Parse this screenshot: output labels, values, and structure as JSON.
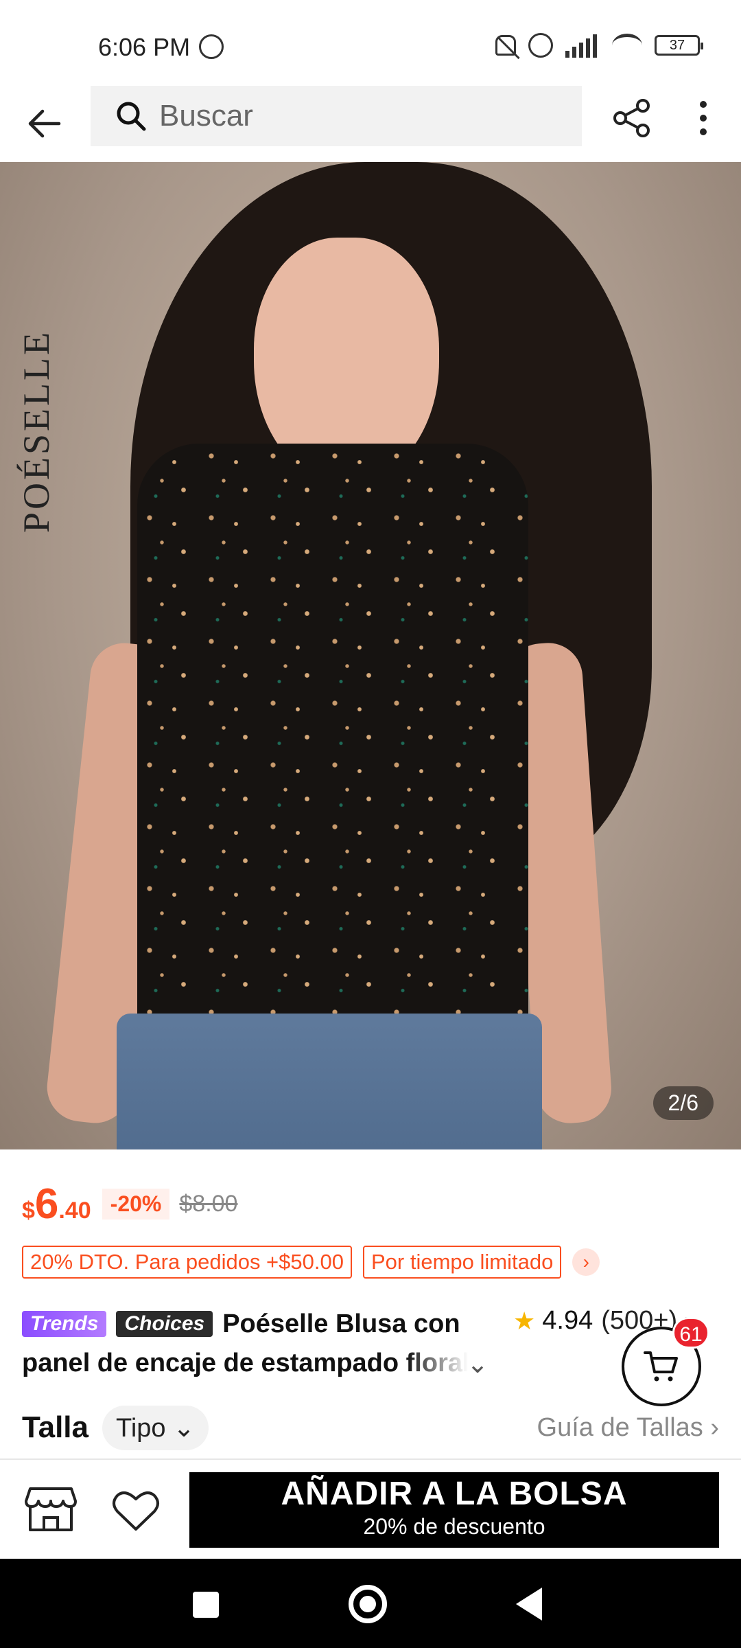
{
  "status_bar": {
    "time": "6:06 PM",
    "battery_level": "37",
    "icons": [
      "whatsapp-icon",
      "mute-icon",
      "alarm-icon",
      "signal-icon",
      "wifi-icon",
      "battery-icon"
    ]
  },
  "top_nav": {
    "search_placeholder": "Buscar",
    "icons": [
      "back-arrow-icon",
      "search-icon",
      "share-icon",
      "more-vert-icon"
    ]
  },
  "product_image": {
    "brand_watermark": "POÉSELLE",
    "counter": "2/6"
  },
  "price": {
    "currency": "$",
    "integer": "6",
    "decimal": ".40",
    "discount": "-20%",
    "original": "$8.00"
  },
  "promos": {
    "deal": "20% DTO. Para pedidos +$50.00",
    "limited": "Por tiempo limitado",
    "arrow": "›"
  },
  "title": {
    "badge_trends": "Trends",
    "badge_choices": "Choices",
    "line1": "Poéselle Blusa con",
    "line2": "panel de encaje de estampado floral",
    "expand_caret": "⌄"
  },
  "rating": {
    "score": "4.94",
    "count": "(500+)",
    "chevron": "›"
  },
  "cart": {
    "badge_count": "61"
  },
  "size": {
    "label": "Talla",
    "type_chip": "Tipo",
    "chip_caret": "⌄",
    "guide": "Guía de Tallas",
    "guide_chevron": "›"
  },
  "action_bar": {
    "add_to_bag": "AÑADIR A LA BOLSA",
    "add_to_bag_sub": "20% de descuento"
  },
  "colors": {
    "accent": "#fa4e1f",
    "cart_badge": "#e9232e",
    "star": "#f7b500",
    "primary_button": "#000000"
  }
}
